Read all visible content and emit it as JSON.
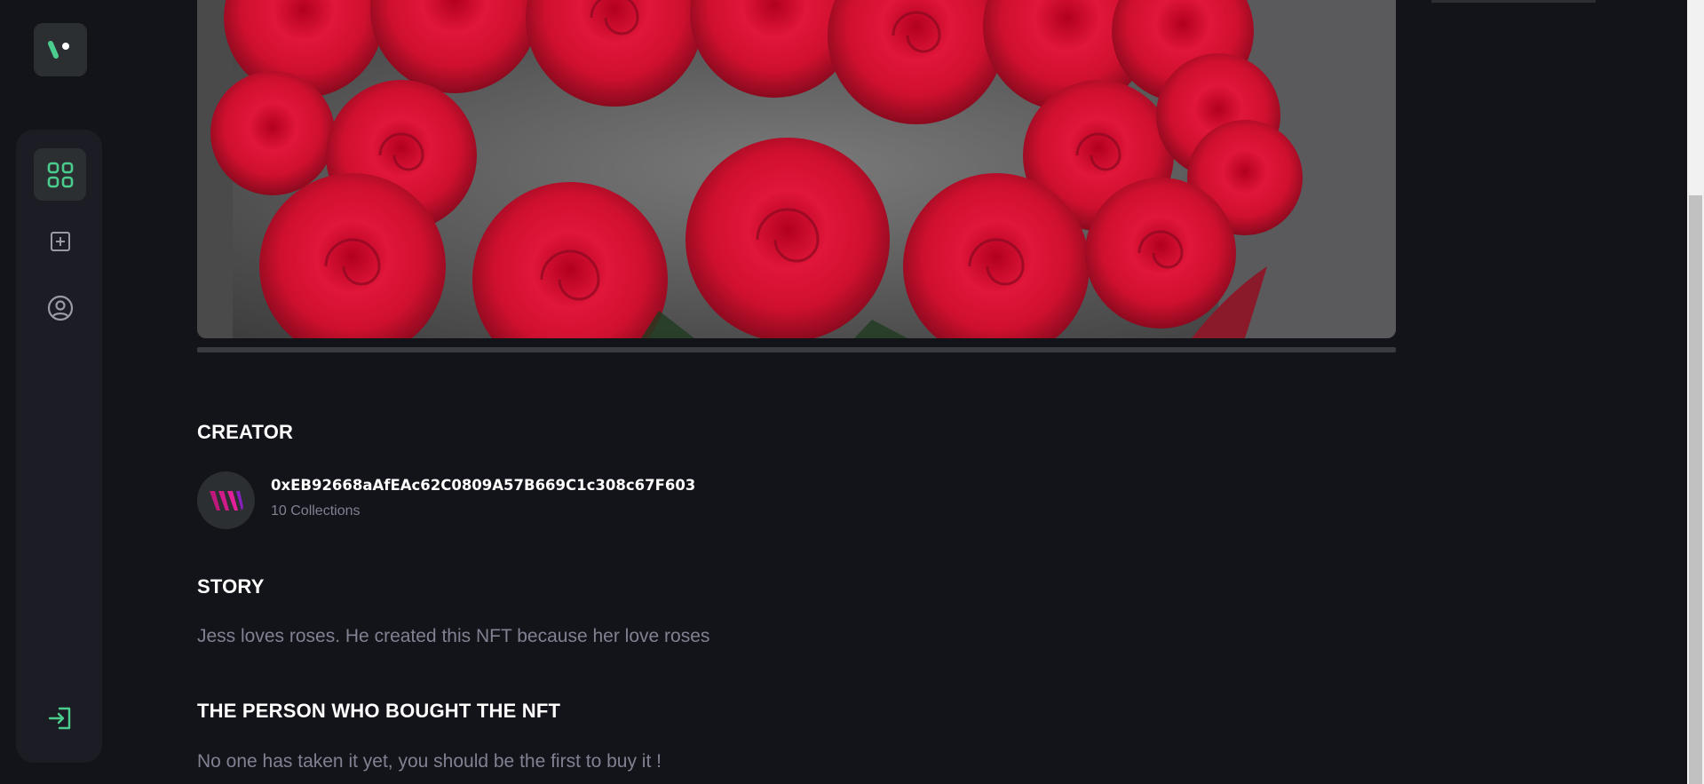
{
  "sidebar": {
    "logo_icon": "brand-logo-icon",
    "nav_items": [
      {
        "name": "dashboard",
        "icon": "grid-icon",
        "active": true
      },
      {
        "name": "create-campaign",
        "icon": "plus-square-icon",
        "active": false
      },
      {
        "name": "profile",
        "icon": "user-circle-icon",
        "active": false
      }
    ],
    "logout_icon": "login-arrow-icon"
  },
  "nft": {
    "image_subject": "red roses bouquet",
    "progress_fraction": 0
  },
  "creator": {
    "heading": "CREATOR",
    "address": "0xEB92668aAfEAc62C0809A57B669C1c308c67F603",
    "collections": "10 Collections"
  },
  "story": {
    "heading": "STORY",
    "text": "Jess loves roses. He created this NFT because her love roses"
  },
  "buyer": {
    "heading": "THE PERSON WHO BOUGHT THE NFT",
    "text": "No one has taken it yet, you should be the first to buy it !"
  },
  "colors": {
    "background": "#13131a",
    "panel": "#1c1c24",
    "accent": "#4acd8d",
    "muted_text": "#808191"
  }
}
